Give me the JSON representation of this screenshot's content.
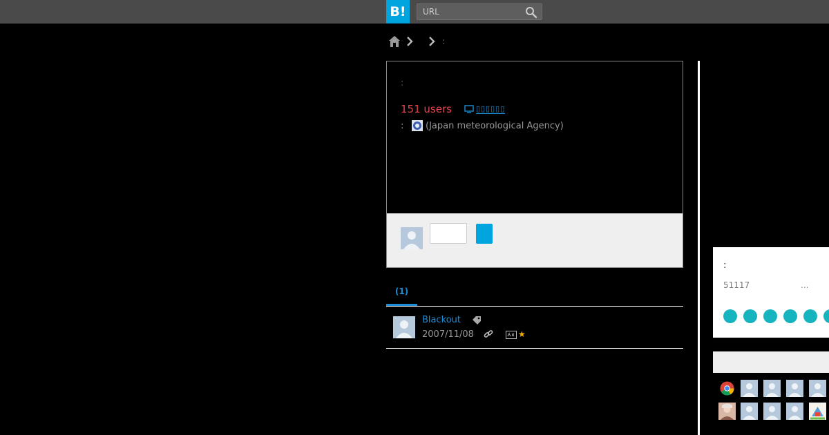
{
  "header": {
    "logo_text": "B!",
    "search_placeholder": "URL"
  },
  "breadcrumb": {
    "last_text": ":"
  },
  "entry": {
    "colon_top": ":",
    "users_count": "151 users",
    "tv_label": "▯▯▯▯▯▯",
    "source_colon": ":",
    "source_text": "(Japan meteorological Agency)"
  },
  "tabs": {
    "active_label": "(1)"
  },
  "bookmark": {
    "user": "Blackout",
    "date": "2007/11/08",
    "star": "★"
  },
  "side": {
    "colon": ":",
    "number": "51117",
    "ellipsis": "..."
  },
  "colors": {
    "accent": "#00a4de",
    "users": "#e4454e",
    "link": "#1a8ed8",
    "dot": "#16b4be"
  }
}
